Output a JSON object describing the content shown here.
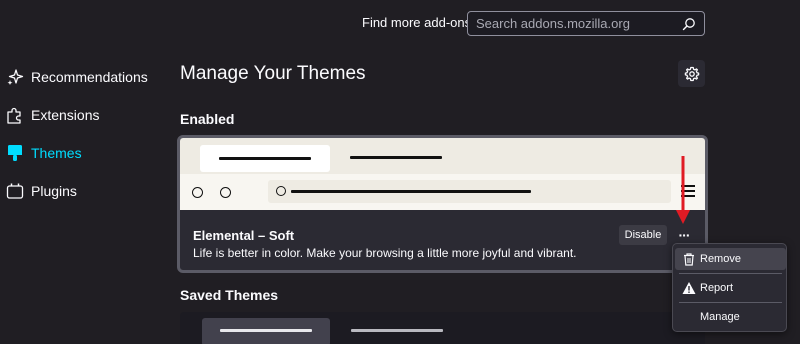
{
  "header": {
    "find_label": "Find more add-ons",
    "search_placeholder": "Search addons.mozilla.org",
    "search_value": ""
  },
  "sidebar": {
    "items": [
      {
        "label": "Recommendations",
        "icon": "sparkle-icon",
        "active": false
      },
      {
        "label": "Extensions",
        "icon": "puzzle-icon",
        "active": false
      },
      {
        "label": "Themes",
        "icon": "paintbrush-icon",
        "active": true
      },
      {
        "label": "Plugins",
        "icon": "plugin-icon",
        "active": false
      }
    ]
  },
  "main": {
    "title": "Manage Your Themes",
    "settings_icon": "gear-icon",
    "enabled_heading": "Enabled",
    "saved_heading": "Saved Themes",
    "enabled_theme": {
      "name": "Elemental – Soft",
      "description": "Life is better in color. Make your browsing a little more joyful and vibrant.",
      "disable_label": "Disable",
      "more_label": "···"
    }
  },
  "context_menu": {
    "items": [
      {
        "label": "Remove",
        "icon": "trash-icon",
        "highlighted": true
      },
      {
        "label": "Report",
        "icon": "warning-icon",
        "highlighted": false
      },
      {
        "label": "Manage",
        "icon": "",
        "highlighted": false
      }
    ]
  },
  "colors": {
    "background": "#201e23",
    "accent": "#00ddff",
    "annotation_arrow": "#e01b24",
    "card_border": "#5b5b66"
  }
}
